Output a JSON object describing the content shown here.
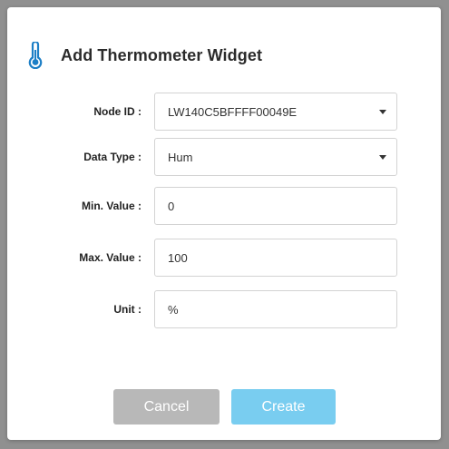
{
  "dialog": {
    "title": "Add Thermometer Widget",
    "icon": "thermometer-icon",
    "accent_color": "#1d7fc6"
  },
  "form": {
    "node_id": {
      "label": "Node ID :",
      "value": "LW140C5BFFFF00049E"
    },
    "data_type": {
      "label": "Data Type :",
      "value": "Hum"
    },
    "min_value": {
      "label": "Min. Value :",
      "value": "0"
    },
    "max_value": {
      "label": "Max. Value :",
      "value": "100"
    },
    "unit": {
      "label": "Unit :",
      "value": "%"
    }
  },
  "buttons": {
    "cancel_label": "Cancel",
    "create_label": "Create",
    "cancel_color": "#b8b8b8",
    "create_color": "#79cdf0"
  }
}
